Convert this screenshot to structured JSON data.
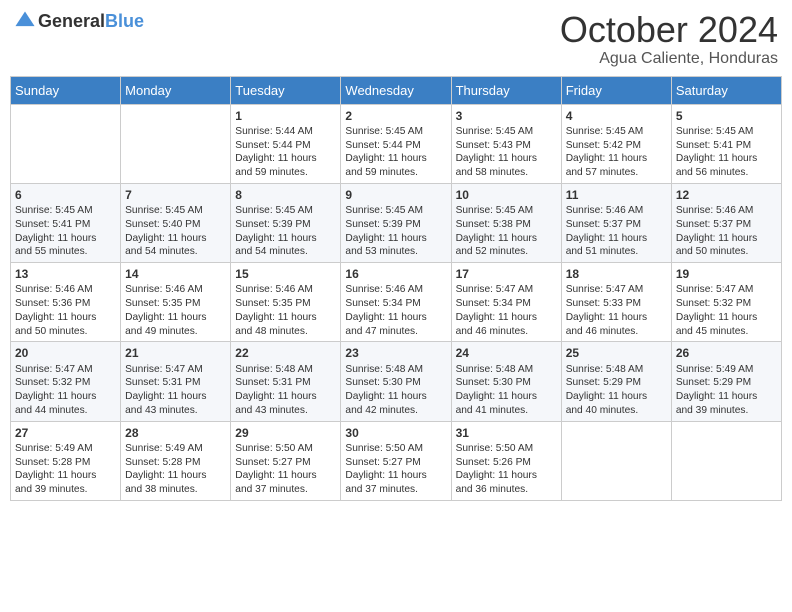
{
  "header": {
    "logo_general": "General",
    "logo_blue": "Blue",
    "month_title": "October 2024",
    "location": "Agua Caliente, Honduras"
  },
  "weekdays": [
    "Sunday",
    "Monday",
    "Tuesday",
    "Wednesday",
    "Thursday",
    "Friday",
    "Saturday"
  ],
  "weeks": [
    [
      {
        "day": "",
        "text": ""
      },
      {
        "day": "",
        "text": ""
      },
      {
        "day": "1",
        "text": "Sunrise: 5:44 AM\nSunset: 5:44 PM\nDaylight: 11 hours and 59 minutes."
      },
      {
        "day": "2",
        "text": "Sunrise: 5:45 AM\nSunset: 5:44 PM\nDaylight: 11 hours and 59 minutes."
      },
      {
        "day": "3",
        "text": "Sunrise: 5:45 AM\nSunset: 5:43 PM\nDaylight: 11 hours and 58 minutes."
      },
      {
        "day": "4",
        "text": "Sunrise: 5:45 AM\nSunset: 5:42 PM\nDaylight: 11 hours and 57 minutes."
      },
      {
        "day": "5",
        "text": "Sunrise: 5:45 AM\nSunset: 5:41 PM\nDaylight: 11 hours and 56 minutes."
      }
    ],
    [
      {
        "day": "6",
        "text": "Sunrise: 5:45 AM\nSunset: 5:41 PM\nDaylight: 11 hours and 55 minutes."
      },
      {
        "day": "7",
        "text": "Sunrise: 5:45 AM\nSunset: 5:40 PM\nDaylight: 11 hours and 54 minutes."
      },
      {
        "day": "8",
        "text": "Sunrise: 5:45 AM\nSunset: 5:39 PM\nDaylight: 11 hours and 54 minutes."
      },
      {
        "day": "9",
        "text": "Sunrise: 5:45 AM\nSunset: 5:39 PM\nDaylight: 11 hours and 53 minutes."
      },
      {
        "day": "10",
        "text": "Sunrise: 5:45 AM\nSunset: 5:38 PM\nDaylight: 11 hours and 52 minutes."
      },
      {
        "day": "11",
        "text": "Sunrise: 5:46 AM\nSunset: 5:37 PM\nDaylight: 11 hours and 51 minutes."
      },
      {
        "day": "12",
        "text": "Sunrise: 5:46 AM\nSunset: 5:37 PM\nDaylight: 11 hours and 50 minutes."
      }
    ],
    [
      {
        "day": "13",
        "text": "Sunrise: 5:46 AM\nSunset: 5:36 PM\nDaylight: 11 hours and 50 minutes."
      },
      {
        "day": "14",
        "text": "Sunrise: 5:46 AM\nSunset: 5:35 PM\nDaylight: 11 hours and 49 minutes."
      },
      {
        "day": "15",
        "text": "Sunrise: 5:46 AM\nSunset: 5:35 PM\nDaylight: 11 hours and 48 minutes."
      },
      {
        "day": "16",
        "text": "Sunrise: 5:46 AM\nSunset: 5:34 PM\nDaylight: 11 hours and 47 minutes."
      },
      {
        "day": "17",
        "text": "Sunrise: 5:47 AM\nSunset: 5:34 PM\nDaylight: 11 hours and 46 minutes."
      },
      {
        "day": "18",
        "text": "Sunrise: 5:47 AM\nSunset: 5:33 PM\nDaylight: 11 hours and 46 minutes."
      },
      {
        "day": "19",
        "text": "Sunrise: 5:47 AM\nSunset: 5:32 PM\nDaylight: 11 hours and 45 minutes."
      }
    ],
    [
      {
        "day": "20",
        "text": "Sunrise: 5:47 AM\nSunset: 5:32 PM\nDaylight: 11 hours and 44 minutes."
      },
      {
        "day": "21",
        "text": "Sunrise: 5:47 AM\nSunset: 5:31 PM\nDaylight: 11 hours and 43 minutes."
      },
      {
        "day": "22",
        "text": "Sunrise: 5:48 AM\nSunset: 5:31 PM\nDaylight: 11 hours and 43 minutes."
      },
      {
        "day": "23",
        "text": "Sunrise: 5:48 AM\nSunset: 5:30 PM\nDaylight: 11 hours and 42 minutes."
      },
      {
        "day": "24",
        "text": "Sunrise: 5:48 AM\nSunset: 5:30 PM\nDaylight: 11 hours and 41 minutes."
      },
      {
        "day": "25",
        "text": "Sunrise: 5:48 AM\nSunset: 5:29 PM\nDaylight: 11 hours and 40 minutes."
      },
      {
        "day": "26",
        "text": "Sunrise: 5:49 AM\nSunset: 5:29 PM\nDaylight: 11 hours and 39 minutes."
      }
    ],
    [
      {
        "day": "27",
        "text": "Sunrise: 5:49 AM\nSunset: 5:28 PM\nDaylight: 11 hours and 39 minutes."
      },
      {
        "day": "28",
        "text": "Sunrise: 5:49 AM\nSunset: 5:28 PM\nDaylight: 11 hours and 38 minutes."
      },
      {
        "day": "29",
        "text": "Sunrise: 5:50 AM\nSunset: 5:27 PM\nDaylight: 11 hours and 37 minutes."
      },
      {
        "day": "30",
        "text": "Sunrise: 5:50 AM\nSunset: 5:27 PM\nDaylight: 11 hours and 37 minutes."
      },
      {
        "day": "31",
        "text": "Sunrise: 5:50 AM\nSunset: 5:26 PM\nDaylight: 11 hours and 36 minutes."
      },
      {
        "day": "",
        "text": ""
      },
      {
        "day": "",
        "text": ""
      }
    ]
  ]
}
